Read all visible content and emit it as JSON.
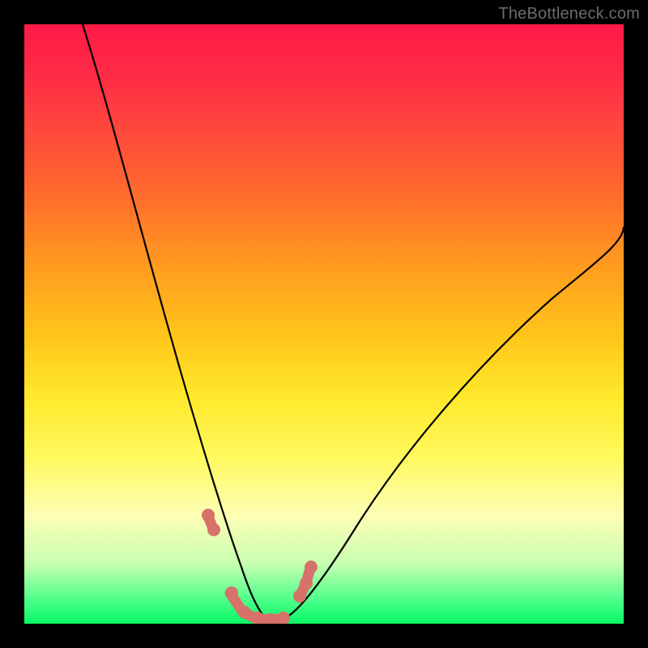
{
  "watermark": "TheBottleneck.com",
  "chart_data": {
    "type": "line",
    "title": "",
    "xlabel": "",
    "ylabel": "",
    "xlim": [
      0,
      100
    ],
    "ylim": [
      0,
      100
    ],
    "grid": false,
    "series": [
      {
        "name": "curve",
        "x": [
          10,
          14,
          18,
          22,
          26,
          30,
          32,
          34,
          36,
          37,
          38,
          40,
          42,
          45,
          50,
          55,
          60,
          65,
          70,
          75,
          80,
          85,
          90,
          95,
          100
        ],
        "y": [
          100,
          86,
          72,
          58,
          44,
          28,
          20,
          12,
          5,
          2,
          0,
          0,
          0,
          2,
          8,
          15,
          23,
          30,
          37,
          43,
          49,
          54,
          59,
          63,
          67
        ]
      }
    ],
    "highlight": {
      "name": "dots",
      "x": [
        30,
        31,
        34,
        36.5,
        38,
        40,
        42.5,
        45,
        46,
        47
      ],
      "y": [
        18,
        16,
        3,
        1,
        0.5,
        0.5,
        0.5,
        3,
        9,
        12
      ]
    },
    "background_gradient": {
      "top": "#ff1a46",
      "mid": "#ffe82a",
      "bottom": "#08f764"
    }
  }
}
